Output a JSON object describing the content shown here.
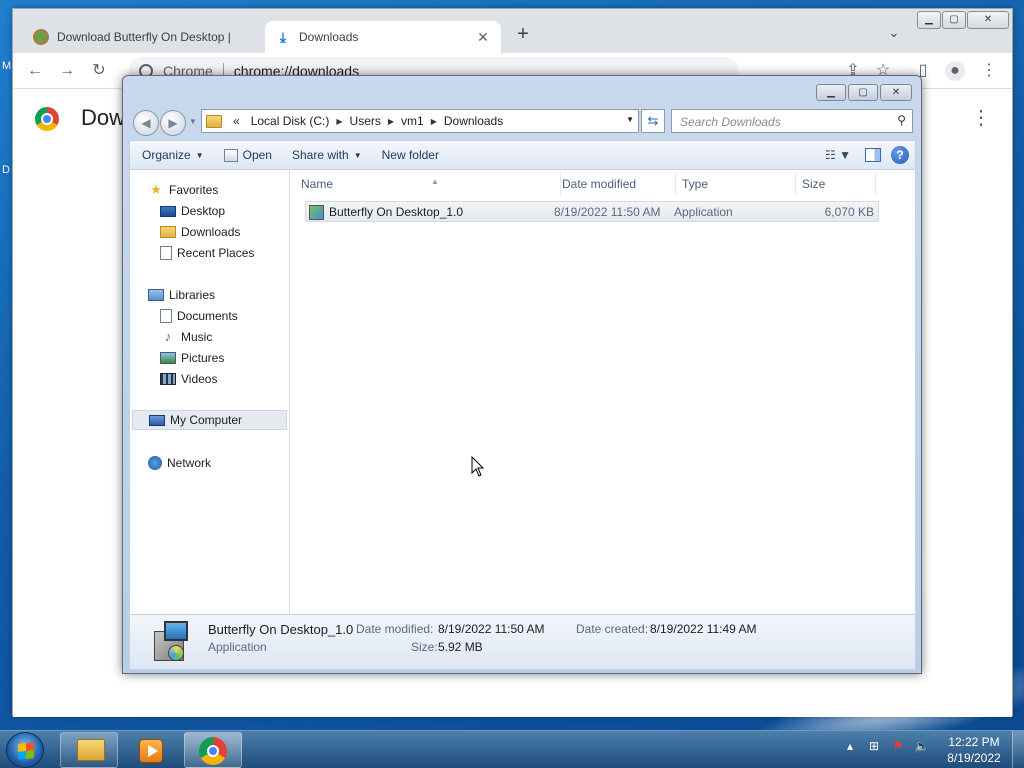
{
  "desktop": {
    "edge_letters": [
      "M",
      "D"
    ]
  },
  "chrome": {
    "tabs": [
      {
        "title": "Download Butterfly On Desktop |",
        "state": "inactive"
      },
      {
        "title": "Downloads",
        "state": "active"
      }
    ],
    "new_tab_label": "+",
    "omnibox": {
      "site_label": "Chrome",
      "url": "chrome://downloads"
    },
    "page": {
      "title": "Downl"
    }
  },
  "explorer": {
    "breadcrumbs": [
      "«",
      "Local Disk (C:)",
      "Users",
      "vm1",
      "Downloads"
    ],
    "search_placeholder": "Search Downloads",
    "toolbar": {
      "organize": "Organize",
      "open": "Open",
      "share_with": "Share with",
      "new_folder": "New folder"
    },
    "nav": {
      "favorites": "Favorites",
      "desktop": "Desktop",
      "downloads": "Downloads",
      "recent_places": "Recent Places",
      "libraries": "Libraries",
      "documents": "Documents",
      "music": "Music",
      "pictures": "Pictures",
      "videos": "Videos",
      "my_computer": "My Computer",
      "network": "Network"
    },
    "columns": {
      "name": "Name",
      "date_modified": "Date modified",
      "type": "Type",
      "size": "Size"
    },
    "files": [
      {
        "name": "Butterfly On Desktop_1.0",
        "date_modified": "8/19/2022 11:50 AM",
        "type": "Application",
        "size": "6,070 KB"
      }
    ],
    "details": {
      "name": "Butterfly On Desktop_1.0",
      "type": "Application",
      "date_modified_label": "Date modified:",
      "date_modified": "8/19/2022 11:50 AM",
      "date_created_label": "Date created:",
      "date_created": "8/19/2022 11:49 AM",
      "size_label": "Size:",
      "size": "5.92 MB"
    }
  },
  "taskbar": {
    "clock_time": "12:22 PM",
    "clock_date": "8/19/2022"
  },
  "icons": [
    "turtle-favicon",
    "download-icon",
    "chrome-icon",
    "folder-icon",
    "search-icon",
    "help-icon",
    "start-orb-icon",
    "media-player-icon",
    "network-tray-icon",
    "flag-tray-icon",
    "volume-icon"
  ]
}
